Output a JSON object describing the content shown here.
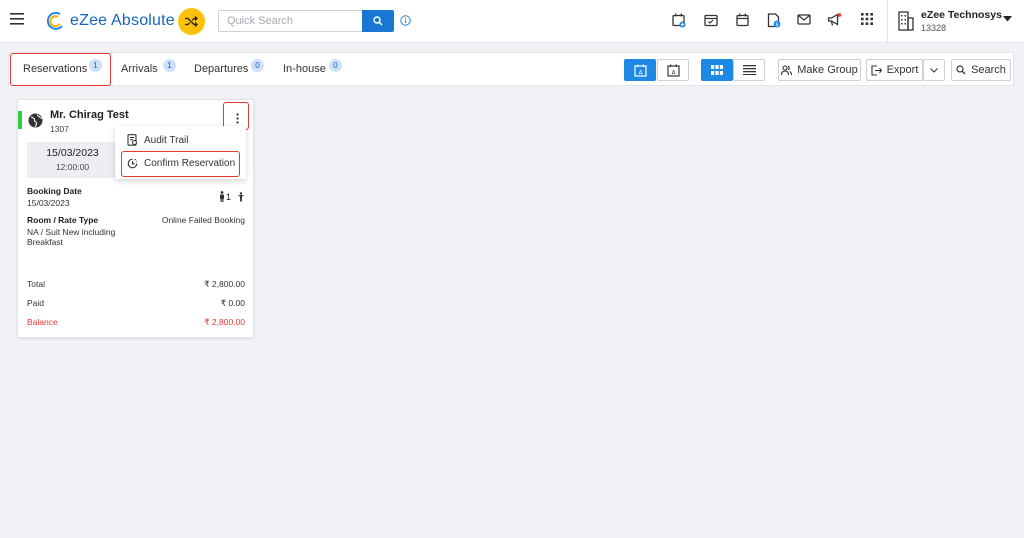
{
  "app": {
    "name": "eZee Absolute",
    "search_placeholder": "Quick Search",
    "top_icons": [
      "calendar-add-icon",
      "calendar-check-icon",
      "calendar-icon",
      "document-dollar-icon",
      "mail-icon",
      "megaphone-icon",
      "apps-grid-icon"
    ],
    "company": {
      "name": "eZee Technosys",
      "id": "13328"
    },
    "accent_color": "#1976d2",
    "shuffle_color": "#ffc107"
  },
  "tabs": [
    {
      "label": "Reservations",
      "badge": "1",
      "active": true
    },
    {
      "label": "Arrivals",
      "badge": "1"
    },
    {
      "label": "Departures",
      "badge": "0"
    },
    {
      "label": "In-house",
      "badge": "0"
    }
  ],
  "toolbar": {
    "make_group": "Make Group",
    "export": "Export",
    "search": "Search"
  },
  "card": {
    "guest_name": "Mr. Chirag Test",
    "room": "1307",
    "arrival_date": "15/03/2023",
    "arrival_time": "12:00:00",
    "booking_date_label": "Booking Date",
    "booking_date": "15/03/2023",
    "adults": "1",
    "room_rate_label": "Room / Rate Type",
    "source": "Online Failed Booking",
    "room_rate": "NA / Suit New including Breakfast",
    "total_label": "Total",
    "total": "₹ 2,800.00",
    "paid_label": "Paid",
    "paid": "₹ 0.00",
    "balance_label": "Balance",
    "balance": "₹ 2,800.00",
    "status_color": "#2ecc40",
    "balance_color": "#e53935"
  },
  "menu": {
    "items": [
      {
        "label": "Audit Trail",
        "icon": "audit-trail-icon"
      },
      {
        "label": "Confirm Reservation",
        "icon": "confirm-clock-icon"
      }
    ]
  }
}
